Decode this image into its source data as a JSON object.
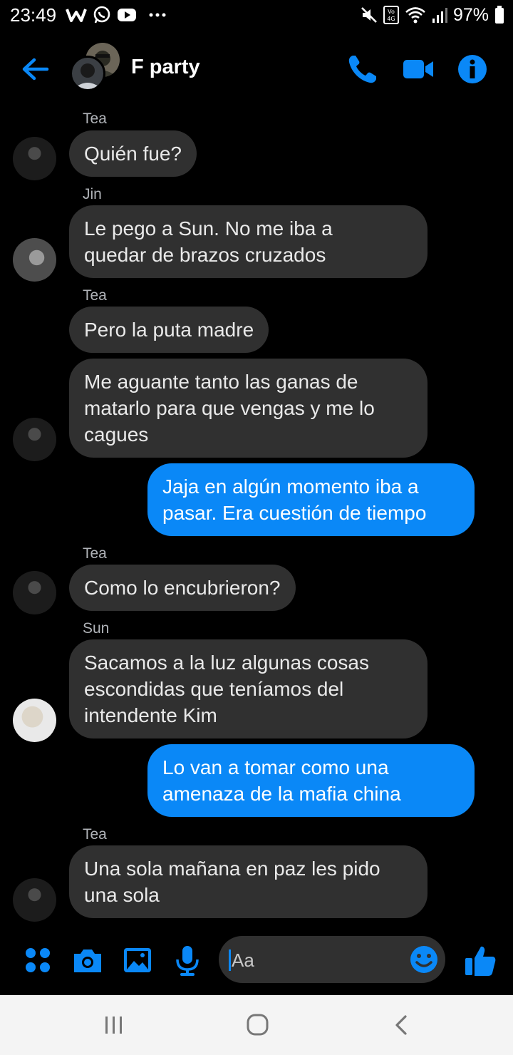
{
  "status_bar": {
    "time": "23:49",
    "battery_text": "97%",
    "icons": [
      "w-app-icon",
      "whatsapp-icon",
      "youtube-icon",
      "more-dots-icon",
      "mute-icon",
      "volte-icon",
      "wifi-icon",
      "signal-icon",
      "battery-icon"
    ]
  },
  "header": {
    "title": "F party",
    "icons": [
      "back-arrow-icon",
      "phone-icon",
      "video-camera-icon",
      "info-icon"
    ]
  },
  "messages": [
    {
      "sender": "Tea",
      "text": "Quién fue?"
    },
    {
      "sender": "Jin",
      "text": "Le pego a Sun. No me iba a\nquedar de brazos cruzados"
    },
    {
      "sender": "Tea",
      "text": "Pero la puta madre"
    },
    {
      "text": "Me aguante tanto las ganas de\nmatarlo para que vengas y me lo\ncagues"
    },
    {
      "text": "Jaja en algún momento iba a\npasar. Era cuestión de tiempo"
    },
    {
      "sender": "Tea",
      "text": "Como lo encubrieron?"
    },
    {
      "sender": "Sun",
      "text": "Sacamos a la luz algunas cosas\nescondidas que teníamos del\nintendente Kim"
    },
    {
      "text": " Lo van a tomar como una\namenaza de la mafia china"
    },
    {
      "sender": "Tea",
      "text": "Una sola mañana en paz les pido\nuna sola"
    }
  ],
  "composer": {
    "placeholder": "Aa",
    "icons": [
      "menu-dots-icon",
      "camera-icon",
      "gallery-icon",
      "microphone-icon",
      "emoji-icon",
      "like-icon"
    ]
  },
  "nav_bar": {
    "icons": [
      "recents-icon",
      "home-icon",
      "back-icon"
    ]
  },
  "colors": {
    "accent": "#0a88f7",
    "incoming_bubble": "#303030",
    "background": "#000000",
    "nav_bar": "#f4f4f4"
  }
}
